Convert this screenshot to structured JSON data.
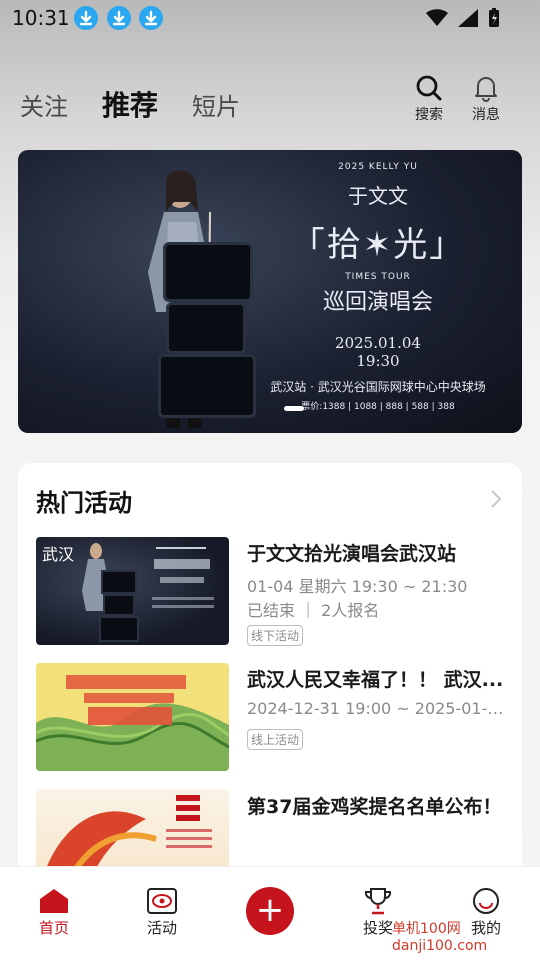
{
  "status_bar": {
    "time": "10:31"
  },
  "top_nav": {
    "tabs": [
      {
        "label": "关注",
        "active": false
      },
      {
        "label": "推荐",
        "active": true
      },
      {
        "label": "短片",
        "active": false
      }
    ],
    "search_label": "搜索",
    "messages_label": "消息"
  },
  "banner": {
    "line1": "2025 KELLY YU",
    "line2": "于文文",
    "line3": "「拾✶光」",
    "line4": "TIMES TOUR",
    "line5": "巡回演唱会",
    "line6": "2025.01.04",
    "line7": "19:30",
    "line8": "武汉站 · 武汉光谷国际网球中心中央球场",
    "line9": "票价:1388 | 1088 | 888 | 588 | 388"
  },
  "hot_activities": {
    "title": "热门活动",
    "items": [
      {
        "thumb_label": "武汉",
        "title": "于文文拾光演唱会武汉站",
        "time": "01-04 星期六 19:30 ~ 21:30",
        "status": "已结束 ｜ 2人报名",
        "tag": "线下活动"
      },
      {
        "title": "武汉人民又幸福了！！ 武汉...",
        "time": "2024-12-31 19:00 ~ 2025-01-0...",
        "tag": "线上活动"
      },
      {
        "title": "第37届金鸡奖提名名单公布！"
      }
    ]
  },
  "bottom_nav": {
    "home": "首页",
    "activity": "活动",
    "add": "+",
    "vote": "投奖",
    "me": "我的"
  },
  "watermark": "单机100网 danji100.com",
  "colors": {
    "accent": "#c6141c",
    "download_badge": "#2aa7f0"
  }
}
